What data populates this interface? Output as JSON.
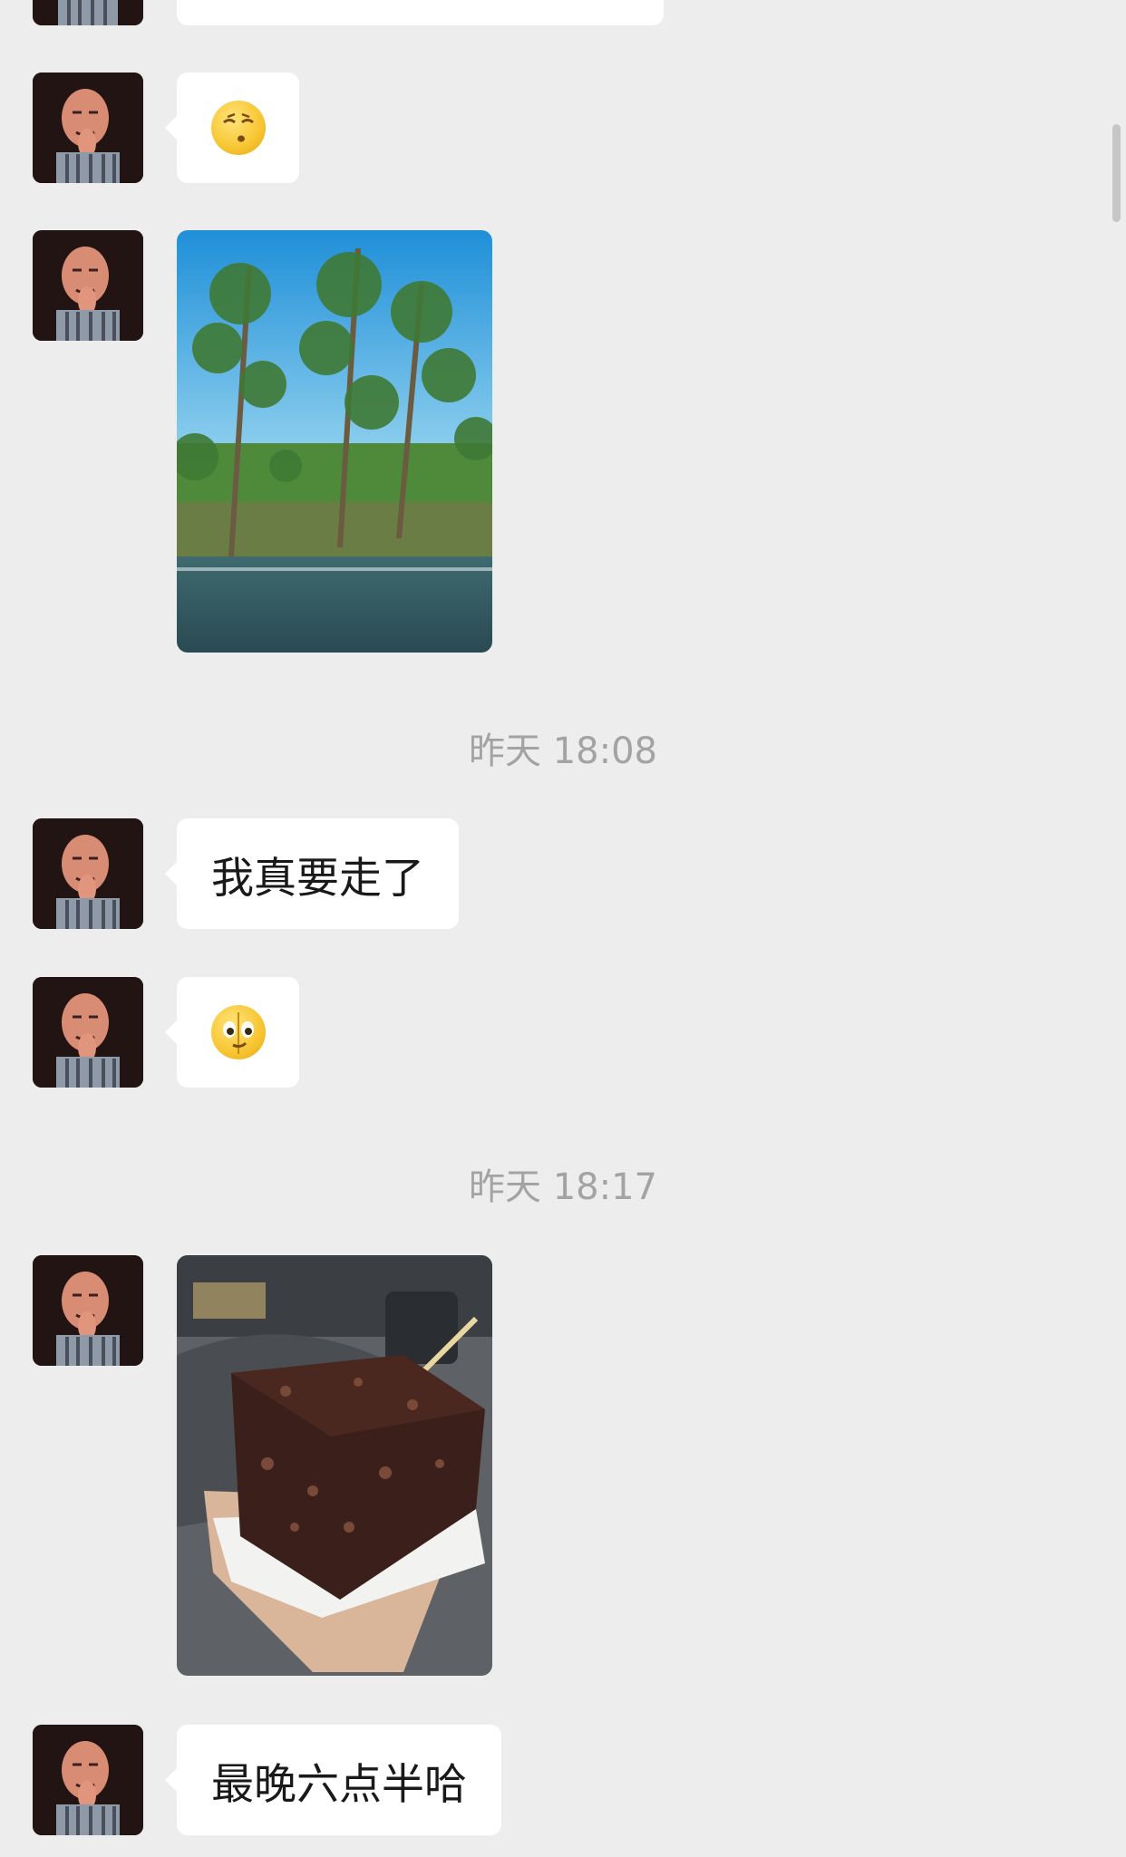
{
  "messages": [
    {
      "kind": "emoji",
      "emoji": "face-exhaling-emoji"
    },
    {
      "kind": "image",
      "image": "roadside-trees-photo"
    },
    {
      "kind": "time",
      "text": "昨天 18:08"
    },
    {
      "kind": "text",
      "text": "我真要走了"
    },
    {
      "kind": "emoji",
      "emoji": "smirk-peek-emoji"
    },
    {
      "kind": "time",
      "text": "昨天 18:17"
    },
    {
      "kind": "image",
      "image": "chocolate-cake-photo"
    },
    {
      "kind": "text",
      "text": "最晚六点半哈"
    }
  ],
  "colors": {
    "background": "#ededed",
    "bubble": "#ffffff",
    "timestamp": "#a3a3a3"
  }
}
